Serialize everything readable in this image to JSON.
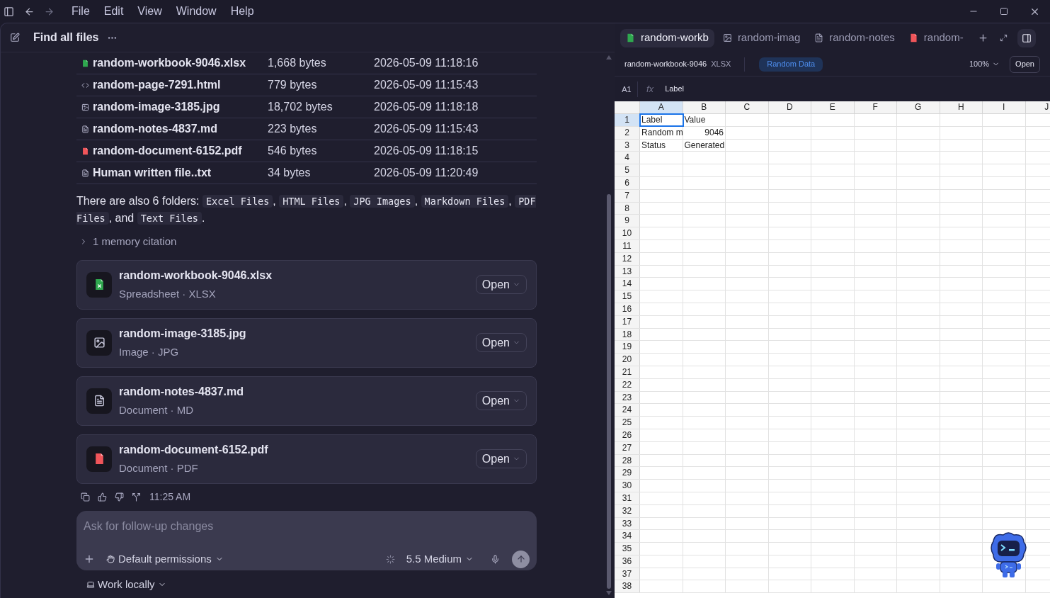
{
  "menu": [
    "File",
    "Edit",
    "View",
    "Window",
    "Help"
  ],
  "thread": {
    "title": "Find all files",
    "files": [
      {
        "kind": "xlsx",
        "name": "random-workbook-9046.xlsx",
        "size": "1,668 bytes",
        "modified": "2026-05-09 11:18:16"
      },
      {
        "kind": "html",
        "name": "random-page-7291.html",
        "size": "779 bytes",
        "modified": "2026-05-09 11:15:43"
      },
      {
        "kind": "image",
        "name": "random-image-3185.jpg",
        "size": "18,702 bytes",
        "modified": "2026-05-09 11:18:18"
      },
      {
        "kind": "md",
        "name": "random-notes-4837.md",
        "size": "223 bytes",
        "modified": "2026-05-09 11:15:43"
      },
      {
        "kind": "pdf",
        "name": "random-document-6152.pdf",
        "size": "546 bytes",
        "modified": "2026-05-09 11:18:15"
      },
      {
        "kind": "txt",
        "name": "Human written file..txt",
        "size": "34 bytes",
        "modified": "2026-05-09 11:20:49"
      }
    ],
    "summary": [
      {
        "kind": "text",
        "text": "There are also 6 folders: "
      },
      {
        "kind": "code",
        "text": "Excel Files"
      },
      {
        "kind": "text",
        "text": ", "
      },
      {
        "kind": "code",
        "text": "HTML Files"
      },
      {
        "kind": "text",
        "text": ", "
      },
      {
        "kind": "code",
        "text": "JPG Images"
      },
      {
        "kind": "text",
        "text": ", "
      },
      {
        "kind": "code",
        "text": "Markdown Files"
      },
      {
        "kind": "text",
        "text": ", "
      },
      {
        "kind": "code",
        "text": "PDF Files"
      },
      {
        "kind": "text",
        "text": ", and "
      },
      {
        "kind": "code",
        "text": "Text Files"
      },
      {
        "kind": "text",
        "text": "."
      }
    ],
    "citation": {
      "label": "1 memory citation",
      "expanded": false
    },
    "cards": [
      {
        "kind": "xlsx",
        "name": "random-workbook-9046.xlsx",
        "type": "Spreadsheet · XLSX",
        "action": "Open"
      },
      {
        "kind": "image",
        "name": "random-image-3185.jpg",
        "type": "Image · JPG",
        "action": "Open"
      },
      {
        "kind": "md",
        "name": "random-notes-4837.md",
        "type": "Document · MD",
        "action": "Open"
      },
      {
        "kind": "pdf",
        "name": "random-document-6152.pdf",
        "type": "Document · PDF",
        "action": "Open"
      }
    ],
    "time": "11:25 AM",
    "composer": {
      "placeholder": "Ask for follow-up changes",
      "permissions": "Default permissions",
      "model": "5.5 Medium"
    },
    "workspace": "Work locally"
  },
  "viewer": {
    "tabs": [
      {
        "kind": "xlsx",
        "label": "random-workb",
        "selected": true
      },
      {
        "kind": "image",
        "label": "random-imag",
        "selected": false
      },
      {
        "kind": "md",
        "label": "random-notes",
        "selected": false
      },
      {
        "kind": "pdf",
        "label": "random-",
        "selected": false
      }
    ],
    "file_name": "random-workbook-9046",
    "file_type": "XLSX",
    "sheet_tab": "Random Data",
    "zoom": "100%",
    "open": "Open",
    "cell_ref": "A1",
    "fx": "fx",
    "formula": "Label",
    "columns": [
      {
        "label": "A",
        "selected": true
      },
      {
        "label": "B",
        "selected": false
      },
      {
        "label": "C",
        "selected": false
      },
      {
        "label": "D",
        "selected": false
      },
      {
        "label": "E",
        "selected": false
      },
      {
        "label": "F",
        "selected": false
      },
      {
        "label": "G",
        "selected": false
      },
      {
        "label": "H",
        "selected": false
      },
      {
        "label": "I",
        "selected": false
      },
      {
        "label": "J",
        "selected": false
      }
    ],
    "rows": [
      {
        "label": "1",
        "selected": true,
        "cells": [
          {
            "kind": "text",
            "text": "Label"
          },
          {
            "kind": "text",
            "text": "Value"
          }
        ]
      },
      {
        "label": "2",
        "selected": false,
        "cells": [
          {
            "kind": "text",
            "text": "Random m"
          },
          {
            "kind": "number",
            "text": "9046"
          }
        ]
      },
      {
        "label": "3",
        "selected": false,
        "cells": [
          {
            "kind": "text",
            "text": "Status"
          },
          {
            "kind": "text",
            "text": "Generated"
          }
        ]
      },
      {
        "label": "4",
        "selected": false
      },
      {
        "label": "5",
        "selected": false
      },
      {
        "label": "6",
        "selected": false
      },
      {
        "label": "7",
        "selected": false
      },
      {
        "label": "8",
        "selected": false
      },
      {
        "label": "9",
        "selected": false
      },
      {
        "label": "10",
        "selected": false
      },
      {
        "label": "11",
        "selected": false
      },
      {
        "label": "12",
        "selected": false
      },
      {
        "label": "13",
        "selected": false
      },
      {
        "label": "14",
        "selected": false
      },
      {
        "label": "15",
        "selected": false
      },
      {
        "label": "16",
        "selected": false
      },
      {
        "label": "17",
        "selected": false
      },
      {
        "label": "18",
        "selected": false
      },
      {
        "label": "19",
        "selected": false
      },
      {
        "label": "20",
        "selected": false
      },
      {
        "label": "21",
        "selected": false
      },
      {
        "label": "22",
        "selected": false
      },
      {
        "label": "23",
        "selected": false
      },
      {
        "label": "24",
        "selected": false
      },
      {
        "label": "25",
        "selected": false
      },
      {
        "label": "26",
        "selected": false
      },
      {
        "label": "27",
        "selected": false
      },
      {
        "label": "28",
        "selected": false
      },
      {
        "label": "29",
        "selected": false
      },
      {
        "label": "30",
        "selected": false
      },
      {
        "label": "31",
        "selected": false
      },
      {
        "label": "32",
        "selected": false
      },
      {
        "label": "33",
        "selected": false
      },
      {
        "label": "34",
        "selected": false
      },
      {
        "label": "35",
        "selected": false
      },
      {
        "label": "36",
        "selected": false
      },
      {
        "label": "37",
        "selected": false
      },
      {
        "label": "38",
        "selected": false
      }
    ]
  }
}
